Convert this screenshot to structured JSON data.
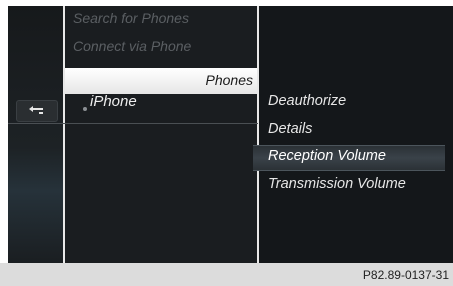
{
  "left_menu": {
    "items_dim": [
      "Search for Phones",
      "Connect via Phone"
    ],
    "selected_header": "Phones"
  },
  "phone_list": {
    "item": "iPhone"
  },
  "options_menu": {
    "items": [
      "Deauthorize",
      "Details",
      "Reception Volume",
      "Transmission Volume"
    ],
    "selected_index": 2
  },
  "caption": "P82.89-0137-31"
}
